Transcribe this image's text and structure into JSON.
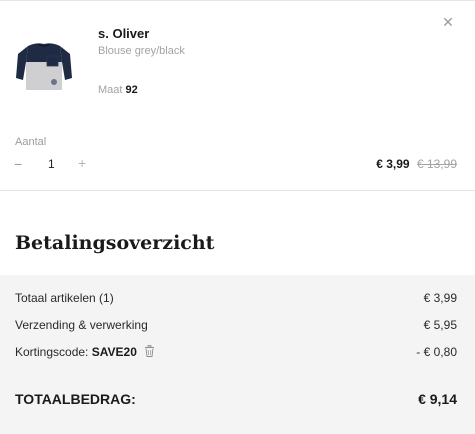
{
  "product": {
    "brand": "s. Oliver",
    "variant": "Blouse grey/black",
    "size_label": "Maat",
    "size_value": "92",
    "image_icon": "shirt-thumbnail",
    "close_icon": "close-icon"
  },
  "quantity": {
    "label": "Aantal",
    "minus": "−",
    "value": "1",
    "plus": "+"
  },
  "price": {
    "current": "€ 3,99",
    "original": "€ 13,99"
  },
  "summary": {
    "title": "Betalingsoverzicht",
    "items_label": "Totaal artikelen (1)",
    "items_value": "€ 3,99",
    "shipping_label": "Verzending & verwerking",
    "shipping_value": "€ 5,95",
    "coupon_label": "Kortingscode:",
    "coupon_code": "SAVE20",
    "coupon_value": "- € 0,80",
    "total_label": "TOTAALBEDRAG:",
    "total_value": "€ 9,14"
  }
}
